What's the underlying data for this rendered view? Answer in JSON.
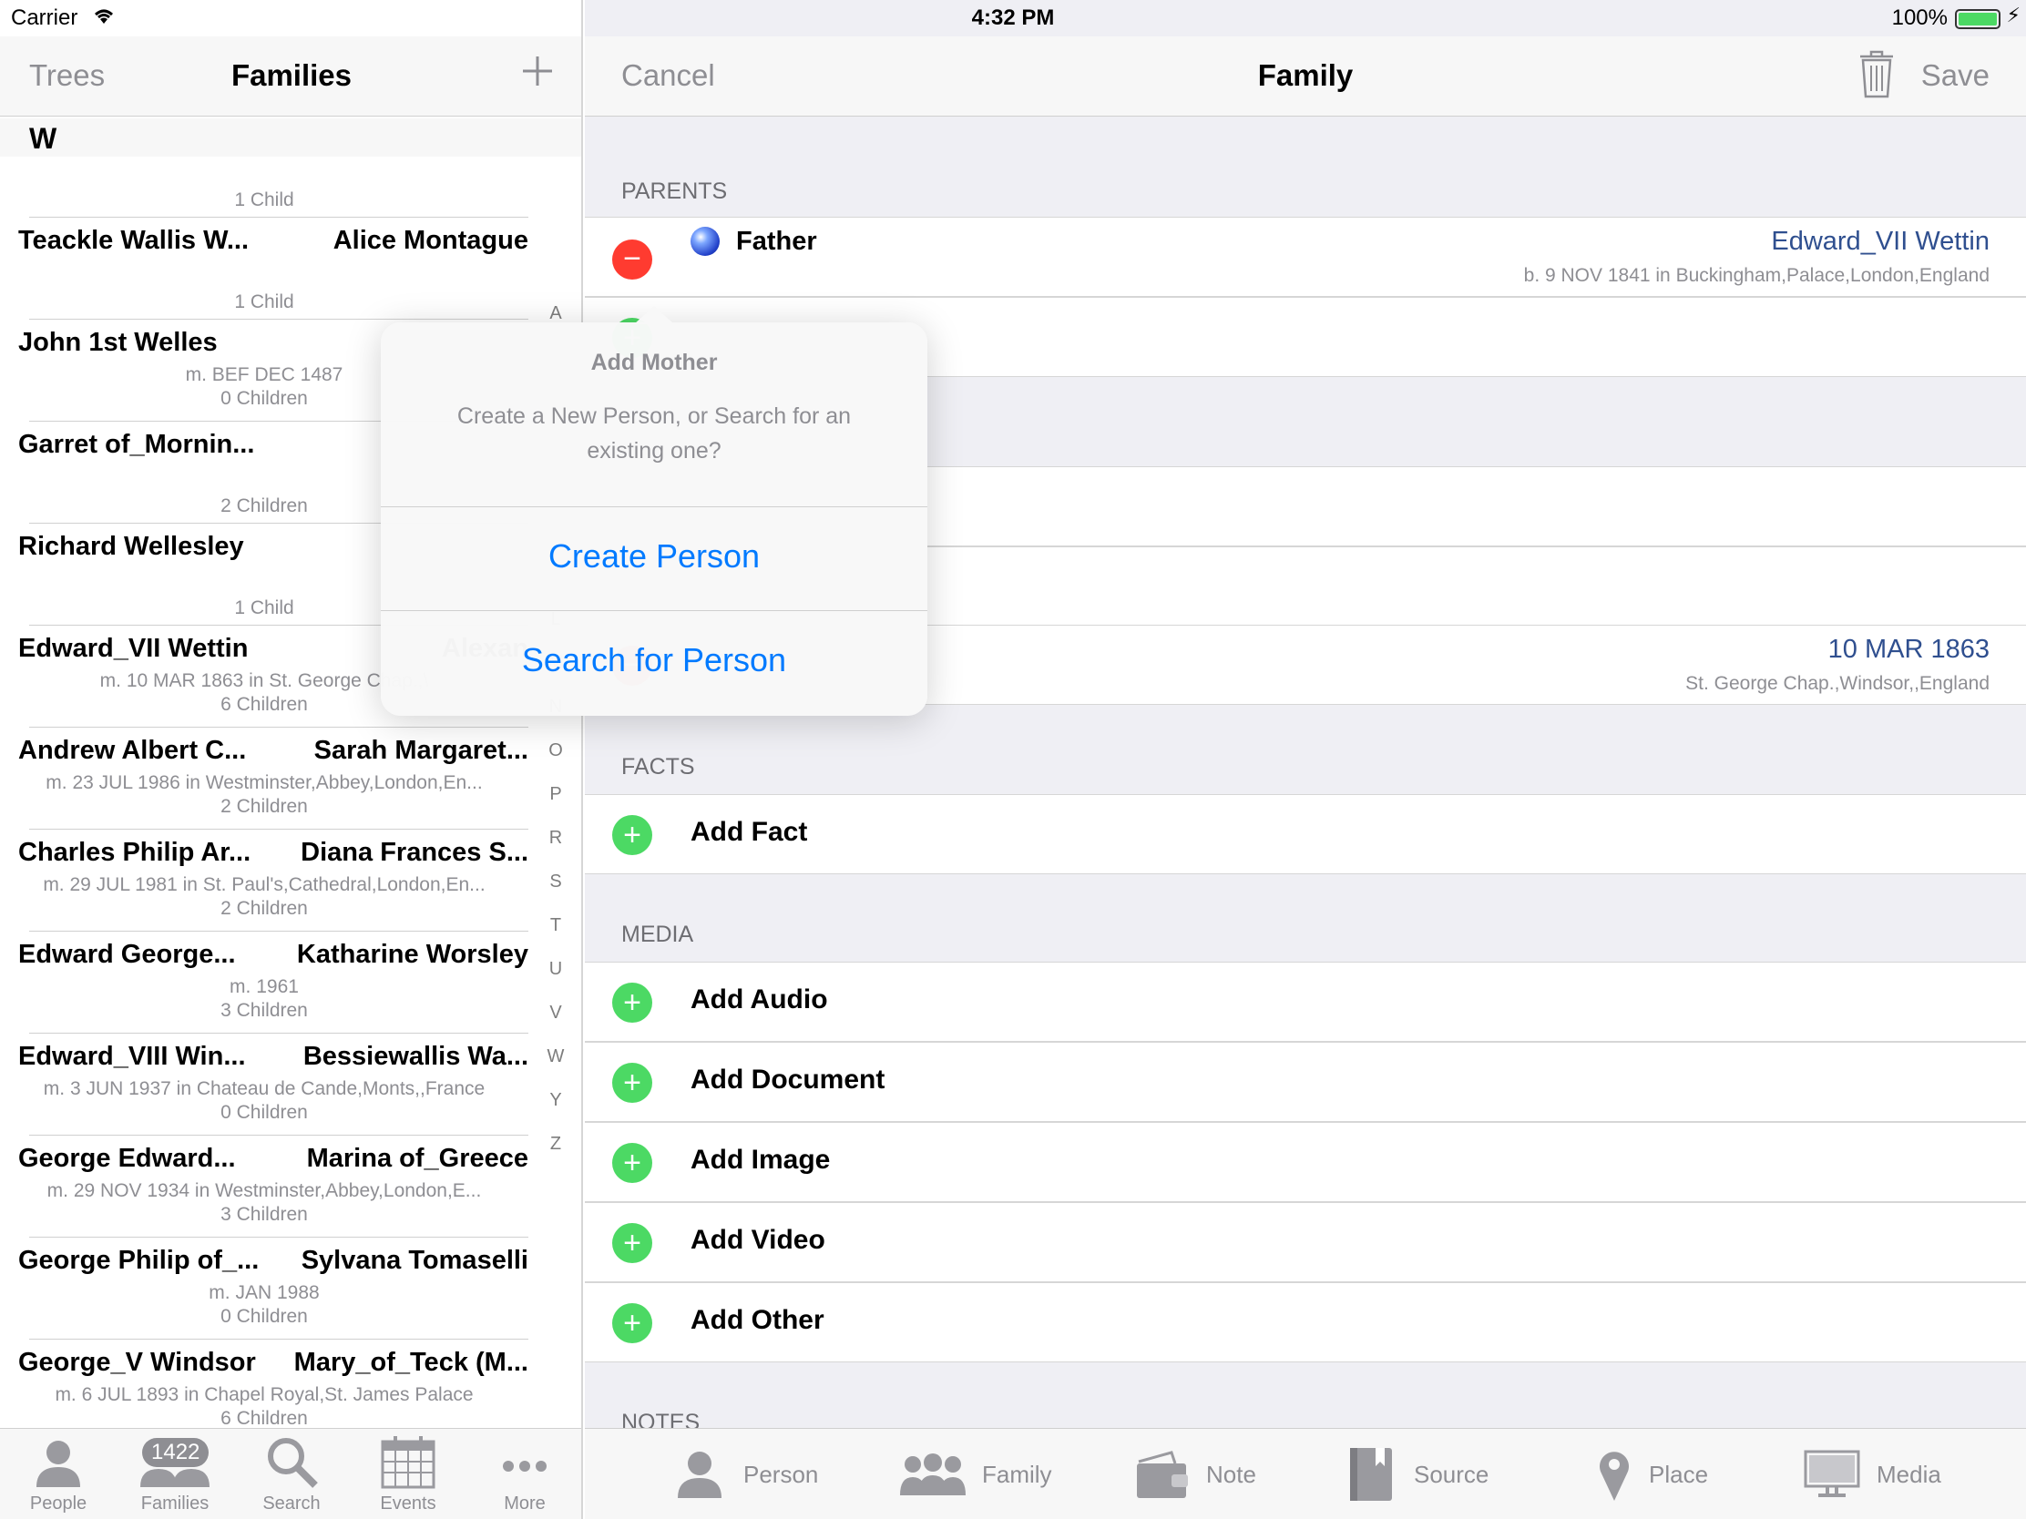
{
  "status_bar": {
    "carrier": "Carrier",
    "time": "4:32 PM",
    "battery": "100%"
  },
  "left_nav": {
    "back_label": "Trees",
    "title": "Families"
  },
  "section_letter": "W",
  "families": [
    {
      "children": "1 Child",
      "marriage": "",
      "husband": "Teackle Wallis W...",
      "wife": "Alice  Montague"
    },
    {
      "children": "1 Child",
      "marriage": "",
      "husband": "John 1st Welles",
      "wife": ""
    },
    {
      "children": "0 Children",
      "marriage": "m. BEF DEC 1487",
      "husband": "Garret of_Mornin...",
      "wife": ""
    },
    {
      "children": "2 Children",
      "marriage": "",
      "husband": "Richard  Wellesley",
      "wife": ""
    },
    {
      "children": "1 Child",
      "marriage": "",
      "husband": "Edward_VII  Wettin",
      "wife": "Alexan"
    },
    {
      "children": "6 Children",
      "marriage": "m. 10 MAR 1863 in St. George Chap.,\\",
      "husband": "Andrew Albert C...",
      "wife": "Sarah Margaret..."
    },
    {
      "children": "2 Children",
      "marriage": "m. 23 JUL 1986 in Westminster,Abbey,London,En...",
      "husband": "Charles Philip Ar...",
      "wife": "Diana Frances S..."
    },
    {
      "children": "2 Children",
      "marriage": "m. 29 JUL 1981 in St. Paul's,Cathedral,London,En...",
      "husband": "Edward George...",
      "wife": "Katharine  Worsley"
    },
    {
      "children": "3 Children",
      "marriage": "m. 1961",
      "husband": "Edward_VIII  Win...",
      "wife": "Bessiewallis  Wa..."
    },
    {
      "children": "0 Children",
      "marriage": "m. 3 JUN 1937 in Chateau de Cande,Monts,,France",
      "husband": "George Edward...",
      "wife": "Marina of_Greece"
    },
    {
      "children": "3 Children",
      "marriage": "m. 29 NOV 1934 in Westminster,Abbey,London,E...",
      "husband": "George Philip of_...",
      "wife": "Sylvana  Tomaselli"
    },
    {
      "children": "0 Children",
      "marriage": "m. JAN 1988",
      "husband": "George_V  Windsor",
      "wife": "Mary_of_Teck (M..."
    },
    {
      "children": "6 Children",
      "marriage": "m. 6 JUL 1893 in Chapel Royal,St. James Palace",
      "husband": "",
      "wife": ""
    }
  ],
  "index_letters": [
    "A",
    "",
    "",
    "",
    "",
    "",
    "",
    "L",
    "M",
    "N",
    "O",
    "P",
    "R",
    "S",
    "T",
    "U",
    "V",
    "W",
    "Y",
    "Z"
  ],
  "tabbar": [
    {
      "label": "People",
      "icon": "person-icon"
    },
    {
      "label": "Families",
      "icon": "family-icon",
      "badge": "1422"
    },
    {
      "label": "Search",
      "icon": "search-icon"
    },
    {
      "label": "Events",
      "icon": "calendar-icon"
    },
    {
      "label": "More",
      "icon": "more-icon"
    }
  ],
  "right_nav": {
    "cancel_label": "Cancel",
    "title": "Family",
    "save_label": "Save"
  },
  "parents": {
    "header": "PARENTS",
    "father_label": "Father",
    "father_name": "Edward_VII  Wettin",
    "father_birth": "b. 9 NOV 1841 in Buckingham,Palace,London,England"
  },
  "marriage": {
    "date": "10 MAR 1863",
    "place": "St. George Chap.,Windsor,,England"
  },
  "facts": {
    "header": "FACTS",
    "add_label": "Add Fact"
  },
  "media": {
    "header": "MEDIA",
    "items": [
      "Add Audio",
      "Add Document",
      "Add Image",
      "Add Video",
      "Add Other"
    ]
  },
  "notes": {
    "header": "NOTES"
  },
  "toolbar": [
    {
      "label": "Person",
      "icon": "person-icon"
    },
    {
      "label": "Family",
      "icon": "family-icon"
    },
    {
      "label": "Note",
      "icon": "note-icon"
    },
    {
      "label": "Source",
      "icon": "source-icon"
    },
    {
      "label": "Place",
      "icon": "place-pin-icon"
    },
    {
      "label": "Media",
      "icon": "media-monitor-icon"
    }
  ],
  "popover": {
    "title": "Add Mother",
    "message": "Create a New Person, or Search for an existing one?",
    "create_label": "Create Person",
    "search_label": "Search for Person"
  },
  "colors": {
    "accent": "#007aff",
    "add": "#4cd964",
    "remove": "#ff3b30",
    "link": "#2f4f8f"
  }
}
